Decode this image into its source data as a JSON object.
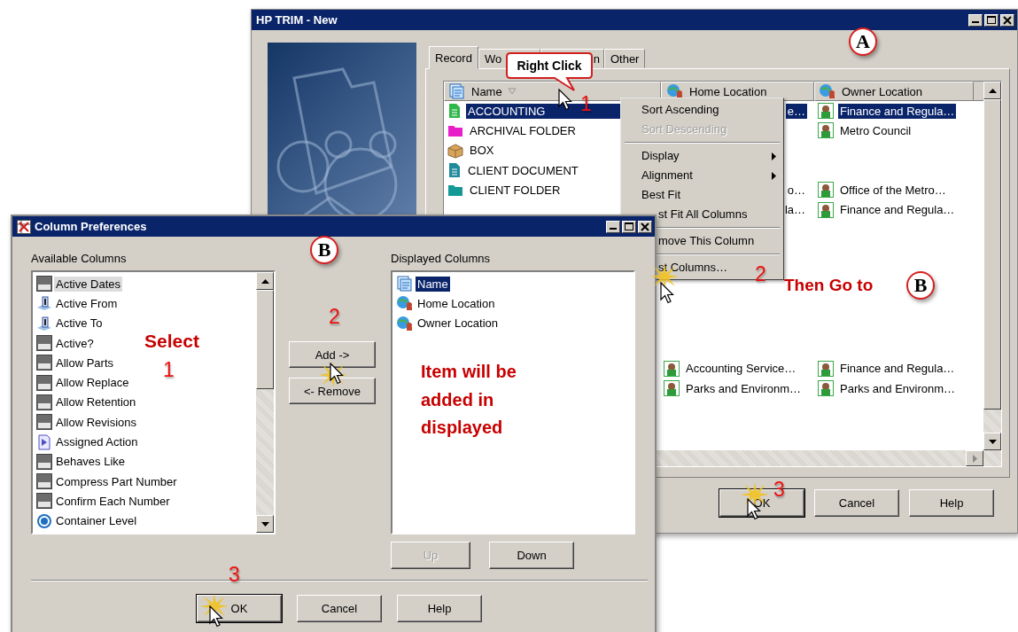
{
  "trim_window": {
    "title": "HP TRIM - New",
    "tabs": [
      {
        "label": "Record",
        "selected": true
      },
      {
        "label": "Wo",
        "selected": false
      },
      {
        "label": "n",
        "selected": false
      },
      {
        "label": "Other",
        "selected": false
      }
    ],
    "columns": [
      {
        "label": "Name",
        "kind": "name"
      },
      {
        "label": "Home Location",
        "kind": "location"
      },
      {
        "label": "Owner Location",
        "kind": "location"
      }
    ],
    "rows": [
      {
        "name": "ACCOUNTING",
        "kind": "document",
        "color": "#2fb84a",
        "home": "e…",
        "owner": "Finance and Regula…",
        "selected": true
      },
      {
        "name": "ARCHIVAL FOLDER",
        "kind": "folder",
        "color": "#e81ec8",
        "owner": "Metro Council",
        "selected": false
      },
      {
        "name": "BOX",
        "kind": "box",
        "color": "#d9a45a",
        "selected": false
      },
      {
        "name": "CLIENT DOCUMENT",
        "kind": "document",
        "color": "#1f8a9a",
        "selected": false
      },
      {
        "name": "CLIENT FOLDER",
        "kind": "folder",
        "color": "#139a96",
        "home": "o…",
        "owner": "Office of the Metro…",
        "selected": false
      },
      {
        "home": "la…",
        "owner": "Finance and Regula…",
        "selected": false
      }
    ],
    "lower_rows": [
      {
        "home": "Accounting Service…",
        "owner": "Finance and Regula…",
        "selected": false
      },
      {
        "home": "Parks and Environm…",
        "owner": "Parks and Environm…",
        "selected": false
      }
    ],
    "buttons": [
      {
        "label": "OK"
      },
      {
        "label": "Cancel"
      },
      {
        "label": "Help"
      }
    ]
  },
  "context_menu": {
    "groups": [
      [
        {
          "label": "Sort Ascending",
          "disabled": false,
          "submenu": false,
          "partly_hidden": false
        },
        {
          "label": "Sort Descending",
          "disabled": true,
          "submenu": false,
          "partly_hidden": false
        }
      ],
      [
        {
          "label": "Display",
          "disabled": false,
          "submenu": true,
          "partly_hidden": false
        },
        {
          "label": "Alignment",
          "disabled": false,
          "submenu": true,
          "partly_hidden": false
        },
        {
          "label": "Best Fit",
          "disabled": false,
          "submenu": false,
          "partly_hidden": false
        },
        {
          "label": "st Fit All Columns",
          "disabled": false,
          "submenu": false,
          "partly_hidden": true
        }
      ],
      [
        {
          "label": "move This Column",
          "disabled": false,
          "submenu": false,
          "partly_hidden": true
        }
      ],
      [
        {
          "label": "st Columns…",
          "disabled": false,
          "submenu": false,
          "partly_hidden": true
        }
      ]
    ]
  },
  "prefs_window": {
    "title": "Column Preferences",
    "available": {
      "label": "Available Columns",
      "items": [
        {
          "label": "Active Dates",
          "kind": "text",
          "selected": true
        },
        {
          "label": "Active From",
          "kind": "date",
          "selected": false
        },
        {
          "label": "Active To",
          "kind": "date",
          "selected": false
        },
        {
          "label": "Active?",
          "kind": "text",
          "selected": false
        },
        {
          "label": "Allow Parts",
          "kind": "text",
          "selected": false
        },
        {
          "label": "Allow Replace",
          "kind": "text",
          "selected": false
        },
        {
          "label": "Allow Retention",
          "kind": "text",
          "selected": false
        },
        {
          "label": "Allow Revisions",
          "kind": "text",
          "selected": false
        },
        {
          "label": "Assigned Action",
          "kind": "action",
          "selected": false
        },
        {
          "label": "Behaves Like",
          "kind": "text",
          "selected": false
        },
        {
          "label": "Compress Part Number",
          "kind": "text",
          "selected": false
        },
        {
          "label": "Confirm Each Number",
          "kind": "text",
          "selected": false
        },
        {
          "label": "Container Level",
          "kind": "number",
          "selected": false
        }
      ]
    },
    "add_button": "Add ->",
    "remove_button": "<- Remove",
    "displayed": {
      "label": "Displayed Columns",
      "items": [
        {
          "label": "Name",
          "kind": "name",
          "selected": true
        },
        {
          "label": "Home Location",
          "kind": "location",
          "selected": false
        },
        {
          "label": "Owner Location",
          "kind": "location",
          "selected": false
        }
      ]
    },
    "up_button": {
      "label": "Up",
      "disabled": true
    },
    "down_button": {
      "label": "Down",
      "disabled": false
    },
    "buttons": [
      {
        "label": "OK"
      },
      {
        "label": "Cancel"
      },
      {
        "label": "Help"
      }
    ]
  },
  "steps": {
    "trim_marker": "A",
    "right_click_callout": "Right Click",
    "right_click_number": "1",
    "edit_columns_number": "2",
    "go_to_text": "Then Go to",
    "go_to_marker": "B",
    "trim_ok_number": "3",
    "prefs_marker": "B",
    "select_text": "Select",
    "select_number": "1",
    "add_number": "2",
    "added_note": "Item will be added in displayed",
    "prefs_ok_number": "3"
  }
}
